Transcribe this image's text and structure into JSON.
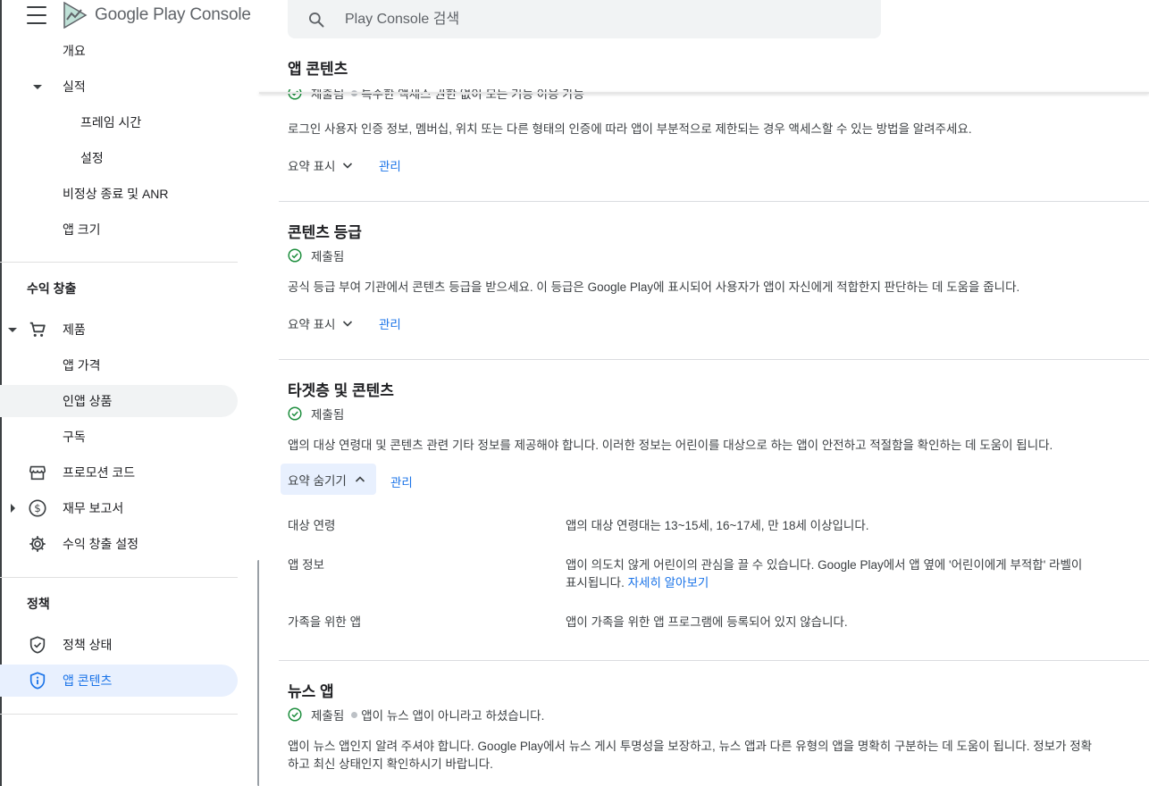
{
  "app": {
    "brand": "Google Play",
    "product": "Console"
  },
  "search": {
    "placeholder": "Play Console 검색"
  },
  "sidebar": {
    "items_top": [
      "개요",
      "실적",
      "프레임 시간",
      "설정",
      "비정상 종료 및 ANR",
      "앱 크기"
    ],
    "monetization": {
      "heading": "수익 창출",
      "items": [
        "제품",
        "앱 가격",
        "인앱 상품",
        "구독",
        "프로모션 코드",
        "재무 보고서",
        "수익 창출 설정"
      ]
    },
    "policy": {
      "heading": "정책",
      "items": [
        "정책 상태",
        "앱 콘텐츠"
      ]
    }
  },
  "page": {
    "title": "앱 콘텐츠"
  },
  "sections": {
    "restricted": {
      "status": "제출됨",
      "status_note": "특수한 액세스 권한 없이 모든 기능 이용 가능",
      "desc": "로그인 사용자 인증 정보, 멤버십, 위치 또는 다른 형태의 인증에 따라 앱이 부분적으로 제한되는 경우 액세스할 수 있는 방법을 알려주세요.",
      "summary": "요약 표시",
      "manage": "관리"
    },
    "rating": {
      "title": "콘텐츠 등급",
      "status": "제출됨",
      "desc": "공식 등급 부여 기관에서 콘텐츠 등급을 받으세요. 이 등급은 Google Play에 표시되어 사용자가 앱이 자신에게 적합한지 판단하는 데 도움을 줍니다.",
      "summary": "요약 표시",
      "manage": "관리"
    },
    "audience": {
      "title": "타겟층 및 콘텐츠",
      "status": "제출됨",
      "desc": "앱의 대상 연령대 및 콘텐츠 관련 기타 정보를 제공해야 합니다. 이러한 정보는 어린이를 대상으로 하는 앱이 안전하고 적절함을 확인하는 데 도움이 됩니다.",
      "summary": "요약 숨기기",
      "manage": "관리",
      "rows": {
        "age_label": "대상 연령",
        "age_value": "앱의 대상 연령대는 13~15세, 16~17세, 만 18세 이상입니다.",
        "info_label": "앱 정보",
        "info_value_1": "앱이 의도치 않게 어린이의 관심을 끌 수 있습니다. Google Play에서 앱 옆에 '어린이에게 부적합' 라벨이",
        "info_value_2": "표시됩니다.",
        "info_link": "자세히 알아보기",
        "family_label": "가족을 위한 앱",
        "family_value": "앱이 가족을 위한 앱 프로그램에 등록되어 있지 않습니다."
      }
    },
    "news": {
      "title": "뉴스 앱",
      "status": "제출됨",
      "status_note": "앱이 뉴스 앱이 아니라고 하셨습니다.",
      "desc_1": "앱이 뉴스 앱인지 알려 주셔야 합니다. Google Play에서 뉴스 게시 투명성을 보장하고, 뉴스 앱과 다른 유형의 앱을 명확히 구분하는 데 도움이 됩니다. 정보가 정확",
      "desc_2": "하고 최신 상태인지 확인하시기 바랍니다."
    }
  },
  "colors": {
    "accent": "#1a73e8",
    "success": "#1e8e3e",
    "active_bg": "#e8f0fe"
  }
}
